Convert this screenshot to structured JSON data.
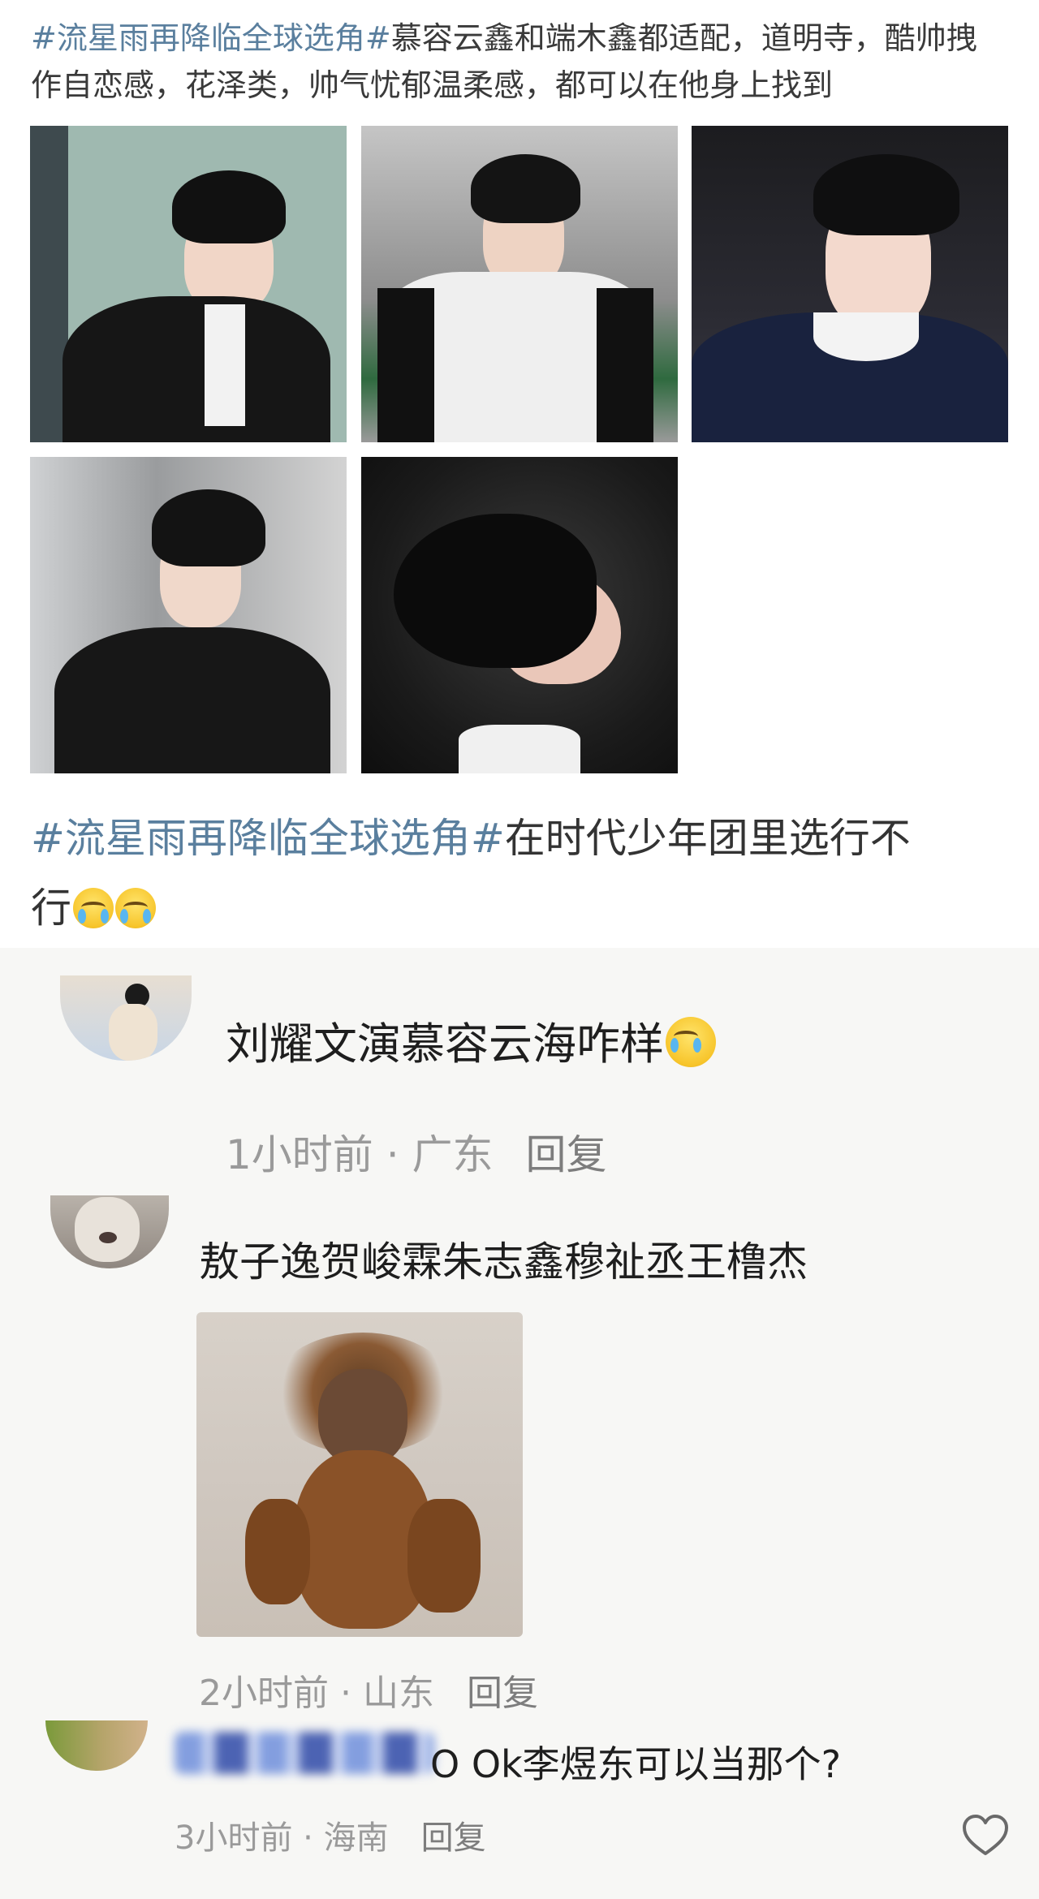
{
  "post": {
    "hashtag": "#流星雨再降临全球选角#",
    "body": "慕容云鑫和端木鑫都适配，道明寺，酷帅拽作自恋感，花泽类，帅气忧郁温柔感，都可以在他身上找到",
    "photo_count": 5
  },
  "repost": {
    "hashtag": "#流星雨再降临全球选角#",
    "body_line1": "在时代少年团里选行不",
    "body_line2": "行"
  },
  "comments": [
    {
      "name": "",
      "text": "刘耀文演慕容云海咋样",
      "time": "1小时前",
      "location": "广东",
      "reply_label": "回复"
    },
    {
      "name": "",
      "text": "敖子逸贺峻霖朱志鑫穆祉丞王橹杰",
      "time": "2小时前",
      "location": "山东",
      "reply_label": "回复"
    },
    {
      "name": "",
      "text_visible": "O Ok李煜东可以当那个?",
      "time": "3小时前",
      "location": "海南",
      "reply_label": "回复"
    }
  ],
  "icons": {
    "emoji": "crying-laughing-emoji",
    "like": "heart-icon"
  },
  "colors": {
    "hashtag": "#5a7f9e",
    "comment_bg": "#f7f7f5",
    "meta": "#9a9a9a"
  }
}
